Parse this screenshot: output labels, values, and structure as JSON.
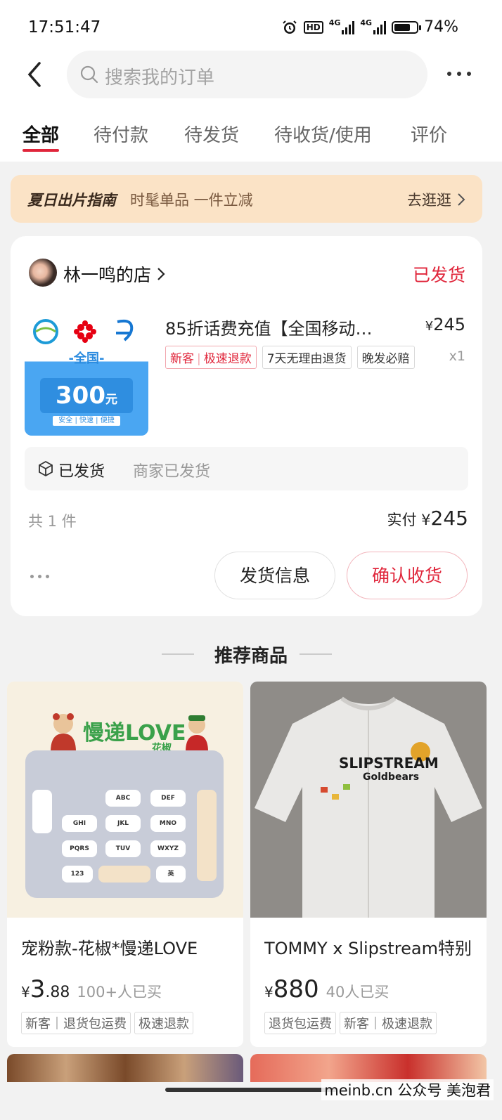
{
  "status_bar": {
    "time": "17:51:47",
    "hd": "HD",
    "network1": "4G",
    "network2": "4G",
    "battery": "74%",
    "battery_level": 0.74
  },
  "search": {
    "placeholder": "搜索我的订单"
  },
  "tabs": [
    {
      "label": "全部",
      "active": true
    },
    {
      "label": "待付款"
    },
    {
      "label": "待发货"
    },
    {
      "label": "待收货/使用"
    },
    {
      "label": "评价"
    }
  ],
  "banner": {
    "brand": "夏日出片指南",
    "slogan": "时髦单品 一件立减",
    "action": "去逛逛"
  },
  "order": {
    "shop_name": "林一鸣的店",
    "status": "已发货",
    "product_title": "85折话费充值【全国移动…",
    "product_price": "245",
    "currency": "¥",
    "tags": [
      "新客",
      "极速退款",
      "7天无理由退货",
      "晚发必赔"
    ],
    "quantity": "x1",
    "thumb": {
      "region": "-全国-",
      "amount": "300",
      "unit": "元",
      "tagline": "安全 | 快速 | 便捷"
    },
    "shipping_status": "已发货",
    "shipping_desc": "商家已发货",
    "item_count": "共 1 件",
    "paid_label": "实付",
    "paid_amount": "245",
    "buttons": {
      "shipping_info": "发货信息",
      "confirm_receipt": "确认收货"
    }
  },
  "recommend": {
    "title": "推荐商品",
    "items": [
      {
        "title": "宠粉款-花椒*慢递LOVE",
        "currency": "¥",
        "price_int": "3",
        "price_dec": ".88",
        "sold": "100+人已买",
        "tags": [
          "新客｜退货包运费",
          "极速退款"
        ],
        "image_text": {
          "headline": "慢递LOVE",
          "sub": "花椒",
          "keys": [
            "ABC",
            "DEF",
            "GHI",
            "JKL",
            "MNO",
            "PQRS",
            "TUV",
            "WXYZ",
            "123",
            "英"
          ]
        }
      },
      {
        "title": "TOMMY x Slipstream特别",
        "currency": "¥",
        "price_int": "880",
        "price_dec": "",
        "sold": "40人已买",
        "tags": [
          "退货包运费",
          "新客｜极速退款"
        ],
        "image_text": {
          "brand": "SLIPSTREAM",
          "sub": "Goldbears"
        }
      }
    ]
  },
  "watermark": "meinb.cn  公众号 美泡君",
  "colors": {
    "accent": "#e0263b",
    "banner_bg": "#fbe3c6",
    "page_bg": "#f2f2f2"
  }
}
